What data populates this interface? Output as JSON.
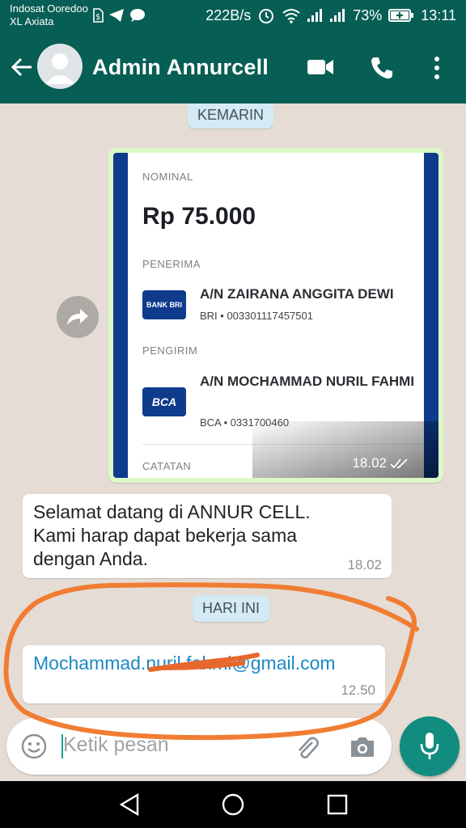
{
  "status_bar": {
    "carrier_1": "Indosat Ooredoo",
    "carrier_2": "XL Axiata",
    "net_speed": "222B/s",
    "battery": "73%",
    "time": "13:11"
  },
  "header": {
    "contact_name": "Admin Annurcell",
    "icons": [
      "back-arrow-icon",
      "avatar",
      "video-call-icon",
      "phone-icon",
      "more-vert-icon"
    ]
  },
  "chat": {
    "date_yesterday": "KEMARIN",
    "date_today": "HARI INI",
    "receipt": {
      "nominal_label": "NOMINAL",
      "amount": "Rp 75.000",
      "receiver_label": "PENERIMA",
      "receiver_bank_logo": "BANK BRI",
      "receiver_name": "A/N ZAIRANA ANGGITA DEWI",
      "receiver_account": "BRI • 003301117457501",
      "sender_label": "PENGIRIM",
      "sender_bank_logo": "BCA",
      "sender_name": "A/N MOCHAMMAD NURIL FAHMI",
      "sender_account": "BCA • 0331700460",
      "notes_label": "CATATAN",
      "time": "18.02"
    },
    "messages": [
      {
        "text": "Selamat datang di ANNUR CELL. Kami harap dapat bekerja sama dengan Anda.",
        "time": "18.02"
      },
      {
        "text": "Mochammad.nuril.fahmi@gmail.com",
        "time": "12.50"
      }
    ]
  },
  "input": {
    "placeholder": "Ketik pesan"
  },
  "colors": {
    "header": "#075e54",
    "accent": "#128c7e",
    "outgoing_bubble": "#dcf8c6",
    "link": "#1e88c5",
    "annotation": "#f07d33"
  }
}
